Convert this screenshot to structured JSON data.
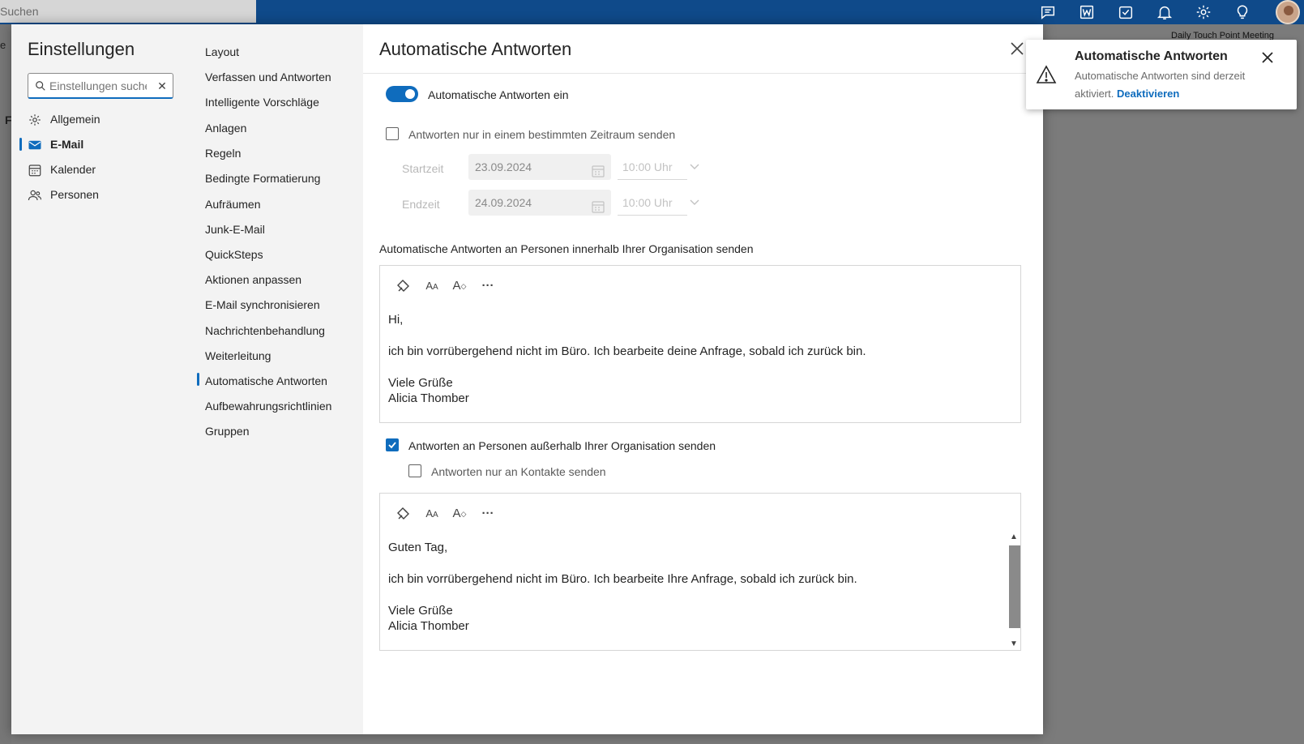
{
  "topbar": {
    "search_placeholder": "Suchen",
    "icons": [
      "chat-icon",
      "word-icon",
      "tasks-icon",
      "bell-icon",
      "gear-icon",
      "lightbulb-icon",
      "avatar"
    ]
  },
  "background": {
    "meeting_text": "Daily Touch Point Meeting",
    "left_letter_1": "e",
    "left_letter_2": "F"
  },
  "settings": {
    "title": "Einstellungen",
    "search_placeholder": "Einstellungen suchen",
    "categories": [
      {
        "label": "Allgemein",
        "icon": "gear-icon"
      },
      {
        "label": "E-Mail",
        "icon": "mail-icon",
        "active": true
      },
      {
        "label": "Kalender",
        "icon": "calendar-icon"
      },
      {
        "label": "Personen",
        "icon": "people-icon"
      }
    ],
    "subcategories": [
      "Layout",
      "Verfassen und Antworten",
      "Intelligente Vorschläge",
      "Anlagen",
      "Regeln",
      "Bedingte Formatierung",
      "Aufräumen",
      "Junk-E-Mail",
      "QuickSteps",
      "Aktionen anpassen",
      "E-Mail synchronisieren",
      "Nachrichtenbehandlung",
      "Weiterleitung",
      "Automatische Antworten",
      "Aufbewahrungsrichtlinien",
      "Gruppen"
    ],
    "active_subcategory": "Automatische Antworten"
  },
  "page": {
    "title": "Automatische Antworten",
    "toggle_label": "Automatische Antworten ein",
    "toggle_on": true,
    "period_label": "Antworten nur in einem bestimmten Zeitraum senden",
    "period_checked": false,
    "start_label": "Startzeit",
    "start_date": "23.09.2024",
    "start_time": "10:00 Uhr",
    "end_label": "Endzeit",
    "end_date": "24.09.2024",
    "end_time": "10:00 Uhr",
    "internal_label": "Automatische Antworten an Personen innerhalb Ihrer Organisation senden",
    "internal_message": {
      "line1": "Hi,",
      "line2": "ich bin vorrübergehend nicht im Büro. Ich bearbeite deine Anfrage, sobald ich zurück bin.",
      "line3": "Viele Grüße",
      "line4": "Alicia Thomber"
    },
    "external_label": "Antworten an Personen außerhalb Ihrer Organisation senden",
    "external_checked": true,
    "contacts_only_label": "Antworten nur an Kontakte senden",
    "contacts_only_checked": false,
    "external_message": {
      "line1": "Guten Tag,",
      "line2": "ich bin vorrübergehend nicht im Büro. Ich bearbeite Ihre Anfrage, sobald ich zurück bin.",
      "line3": "Viele Grüße",
      "line4": "Alicia Thomber"
    },
    "toolbar": [
      "format-painter-icon",
      "font-size-icon",
      "text-effects-icon",
      "more-icon"
    ],
    "more_glyph": "···"
  },
  "toast": {
    "title": "Automatische Antworten",
    "message": "Automatische Antworten sind derzeit aktiviert.",
    "link": "Deaktivieren"
  },
  "colors": {
    "accent": "#0f6cbd",
    "topbar": "#0f4a8a"
  }
}
